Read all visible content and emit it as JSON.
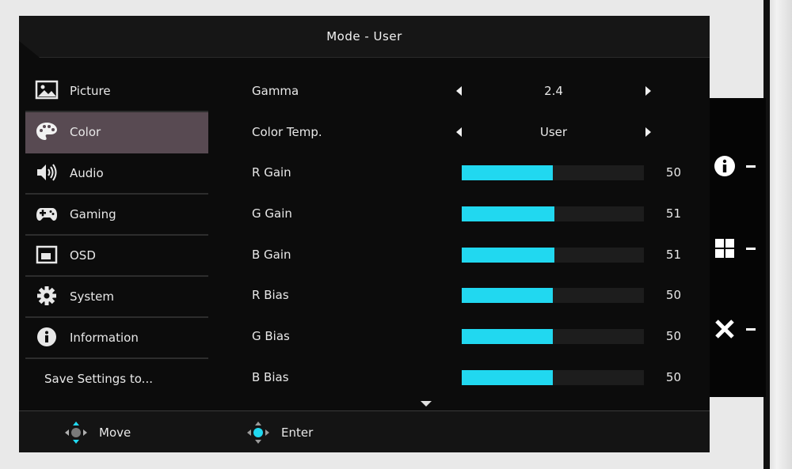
{
  "osd": {
    "title": "Mode - User",
    "sidebar": {
      "items": [
        {
          "label": "Picture",
          "icon": "picture-icon",
          "active": false
        },
        {
          "label": "Color",
          "icon": "palette-icon",
          "active": true
        },
        {
          "label": "Audio",
          "icon": "speaker-icon",
          "active": false
        },
        {
          "label": "Gaming",
          "icon": "gamepad-icon",
          "active": false
        },
        {
          "label": "OSD",
          "icon": "osd-window-icon",
          "active": false
        },
        {
          "label": "System",
          "icon": "gear-icon",
          "active": false
        },
        {
          "label": "Information",
          "icon": "info-icon",
          "active": false
        },
        {
          "label": "Save Settings to...",
          "icon": "",
          "active": false
        }
      ]
    },
    "settings": {
      "gamma": {
        "label": "Gamma",
        "value": "2.4"
      },
      "color_temp": {
        "label": "Color Temp.",
        "value": "User"
      },
      "sliders": [
        {
          "label": "R Gain",
          "value": "50",
          "level": 50
        },
        {
          "label": "G Gain",
          "value": "51",
          "level": 51
        },
        {
          "label": "B Gain",
          "value": "51",
          "level": 51
        },
        {
          "label": "R Bias",
          "value": "50",
          "level": 50
        },
        {
          "label": "G Bias",
          "value": "50",
          "level": 50
        },
        {
          "label": "B Bias",
          "value": "50",
          "level": 50
        }
      ]
    },
    "footer": {
      "move_label": "Move",
      "enter_label": "Enter"
    }
  },
  "side_keys": [
    {
      "icon": "info-icon"
    },
    {
      "icon": "grid-icon"
    },
    {
      "icon": "close-icon"
    }
  ],
  "colors": {
    "accent": "#21d8f0",
    "active_item": "#584a52",
    "panel": "#0c0c0c"
  }
}
